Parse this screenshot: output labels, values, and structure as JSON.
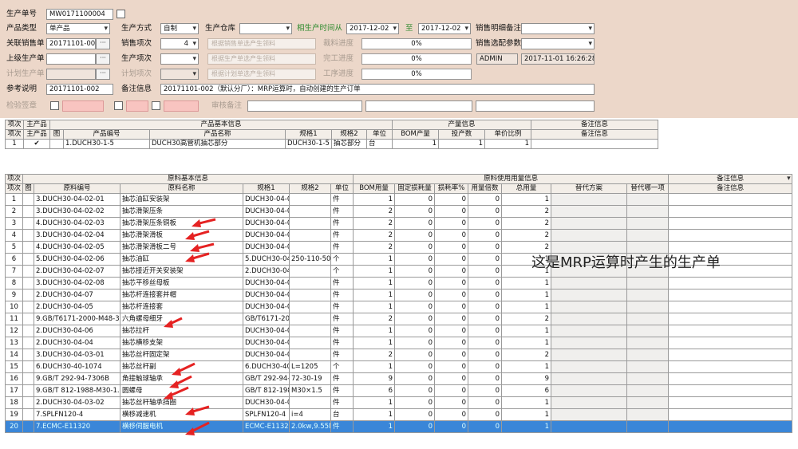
{
  "form": {
    "order_no_label": "生产单号",
    "order_no": "MW0171100004",
    "product_type_label": "产品类型",
    "product_type": "单产品",
    "production_mode_label": "生产方式",
    "production_mode": "自制",
    "warehouse_label": "生产仓库",
    "warehouse": "",
    "date_label": "相生产时间从",
    "date_from": "2017-12-02",
    "date_to_label": "至",
    "date_to": "2017-12-02",
    "sales_note_label": "销售明细备注",
    "sales_note": "",
    "related_sales_label": "关联销售单",
    "related_sales": "20171101-001",
    "sales_item_label": "销售项次",
    "sales_item": "4",
    "btn_sales_material": "根据销售单选产生领料",
    "cut_progress_label": "裁料进度",
    "cut_progress": "0%",
    "sales_config_label": "销售选配参数",
    "sales_config": "",
    "parent_order_label": "上级生产单",
    "parent_order": "",
    "production_item_label": "生产项次",
    "production_item": "",
    "btn_parent_material": "根据生产单选产生领料",
    "complete_progress_label": "完工进度",
    "complete_progress": "0%",
    "user": "ADMIN",
    "created_at": "2017-11-01 16:26:28",
    "related_plan_label": "计划生产单",
    "related_plan": "",
    "plan_item_label": "计划项次",
    "btn_plan_material": "根据计划单选产生领料",
    "process_progress_label": "工序进度",
    "process_progress": "0%",
    "ref_note_label": "参考说明",
    "ref_note": "20171101-002",
    "remark_label": "备注信息",
    "remark": "20171101-002（默认分厂）：MRP运算时，自动创建的生产订单",
    "inspect_label": "检验签章",
    "audit_label": "审核备注"
  },
  "product_table": {
    "group_headers": [
      "项次",
      "主产品",
      "产品基本信息",
      "产量信息",
      "备注信息"
    ],
    "headers": [
      "项次",
      "主产品",
      "图",
      "产品编号",
      "产品名称",
      "规格1",
      "规格2",
      "单位",
      "BOM产量",
      "投产数",
      "单价比例",
      "备注信息"
    ],
    "rows": [
      {
        "idx": "1",
        "main": "✔",
        "pic": "",
        "code": "1.DUCH30-1-5",
        "name": "DUCH30高管机抽芯部分",
        "spec1": "DUCH30-1-5",
        "spec2": "抽芯部分",
        "unit": "台",
        "bom": "1",
        "qty": "1",
        "ratio": "1",
        "note": ""
      }
    ]
  },
  "material_table": {
    "group_headers": [
      "项次",
      "原料基本信息",
      "原料使用用量信息",
      "备注信息"
    ],
    "headers": [
      "项次",
      "图",
      "原料编号",
      "原料名称",
      "规格1",
      "规格2",
      "单位",
      "BOM用量",
      "固定损耗量",
      "损耗率%",
      "用量倍数",
      "总用量",
      "替代方案",
      "替代哪一项",
      "备注信息"
    ],
    "rows": [
      {
        "idx": "1",
        "code": "3.DUCH30-04-02-01",
        "name": "抽芯油缸安装架",
        "spec1": "DUCH30-04-02",
        "spec2": "",
        "unit": "件",
        "bom": "1",
        "fixed": "0",
        "rate": "0",
        "mult": "0",
        "total": "1"
      },
      {
        "idx": "2",
        "code": "3.DUCH30-04-02-02",
        "name": "抽芯滑架压条",
        "spec1": "DUCH30-04-02",
        "spec2": "",
        "unit": "件",
        "bom": "2",
        "fixed": "0",
        "rate": "0",
        "mult": "0",
        "total": "2"
      },
      {
        "idx": "3",
        "code": "4.DUCH30-04-02-03",
        "name": "抽芯滑架压条铜板",
        "spec1": "DUCH30-04-02",
        "spec2": "",
        "unit": "件",
        "bom": "2",
        "fixed": "0",
        "rate": "0",
        "mult": "0",
        "total": "2"
      },
      {
        "idx": "4",
        "code": "3.DUCH30-04-02-04",
        "name": "抽芯滑架滑板",
        "spec1": "DUCH30-04-02",
        "spec2": "",
        "unit": "件",
        "bom": "2",
        "fixed": "0",
        "rate": "0",
        "mult": "0",
        "total": "2"
      },
      {
        "idx": "5",
        "code": "4.DUCH30-04-02-05",
        "name": "抽芯滑架滑板二号",
        "spec1": "DUCH30-04-02",
        "spec2": "",
        "unit": "件",
        "bom": "2",
        "fixed": "0",
        "rate": "0",
        "mult": "0",
        "total": "2"
      },
      {
        "idx": "6",
        "code": "5.DUCH30-04-02-06",
        "name": "抽芯油缸",
        "spec1": "5.DUCH30-04-",
        "spec2": "250-110-500",
        "unit": "个",
        "bom": "1",
        "fixed": "0",
        "rate": "0",
        "mult": "0",
        "total": "1"
      },
      {
        "idx": "7",
        "code": "2.DUCH30-04-02-07",
        "name": "抽芯接近开关安装架",
        "spec1": "2.DUCH30-04-",
        "spec2": "",
        "unit": "个",
        "bom": "1",
        "fixed": "0",
        "rate": "0",
        "mult": "0",
        "total": "1"
      },
      {
        "idx": "8",
        "code": "3.DUCH30-04-02-08",
        "name": "抽芯平移丝母板",
        "spec1": "DUCH30-04-02",
        "spec2": "",
        "unit": "件",
        "bom": "1",
        "fixed": "0",
        "rate": "0",
        "mult": "0",
        "total": "1"
      },
      {
        "idx": "9",
        "code": "2.DUCH30-04-07",
        "name": "抽芯杆连接套并帽",
        "spec1": "DUCH30-04-07",
        "spec2": "",
        "unit": "件",
        "bom": "1",
        "fixed": "0",
        "rate": "0",
        "mult": "0",
        "total": "1"
      },
      {
        "idx": "10",
        "code": "2.DUCH30-04-05",
        "name": "抽芯杆连接套",
        "spec1": "DUCH30-04-05",
        "spec2": "",
        "unit": "件",
        "bom": "1",
        "fixed": "0",
        "rate": "0",
        "mult": "0",
        "total": "1"
      },
      {
        "idx": "11",
        "code": "9.GB/T6171-2000-M48-3",
        "name": "六角螺母细牙",
        "spec1": "GB/T6171-200",
        "spec2": "",
        "unit": "件",
        "bom": "2",
        "fixed": "0",
        "rate": "0",
        "mult": "0",
        "total": "2"
      },
      {
        "idx": "12",
        "code": "2.DUCH30-04-06",
        "name": "抽芯拉杆",
        "spec1": "DUCH30-04-06",
        "spec2": "",
        "unit": "件",
        "bom": "1",
        "fixed": "0",
        "rate": "0",
        "mult": "0",
        "total": "1"
      },
      {
        "idx": "13",
        "code": "2.DUCH30-04-04",
        "name": "抽芯横移支架",
        "spec1": "DUCH30-04-04",
        "spec2": "",
        "unit": "件",
        "bom": "1",
        "fixed": "0",
        "rate": "0",
        "mult": "0",
        "total": "1"
      },
      {
        "idx": "14",
        "code": "3.DUCH30-04-03-01",
        "name": "抽芯丝杆固定架",
        "spec1": "DUCH30-04-03",
        "spec2": "",
        "unit": "件",
        "bom": "2",
        "fixed": "0",
        "rate": "0",
        "mult": "0",
        "total": "2"
      },
      {
        "idx": "15",
        "code": "6.DUCH30-40-1074",
        "name": "抽芯丝杆副",
        "spec1": "6.DUCH30-40-",
        "spec2": "L=1205",
        "unit": "个",
        "bom": "1",
        "fixed": "0",
        "rate": "0",
        "mult": "0",
        "total": "1"
      },
      {
        "idx": "16",
        "code": "9.GB/T 292-94-7306B",
        "name": "角接触球轴承",
        "spec1": "GB/T 292-94-",
        "spec2": "72-30-19",
        "unit": "件",
        "bom": "9",
        "fixed": "0",
        "rate": "0",
        "mult": "0",
        "total": "9"
      },
      {
        "idx": "17",
        "code": "9.GB/T 812-1988-M30-1.5",
        "name": "圆螺母",
        "spec1": "GB/T 812-198",
        "spec2": "M30×1.5",
        "unit": "件",
        "bom": "6",
        "fixed": "0",
        "rate": "0",
        "mult": "0",
        "total": "6"
      },
      {
        "idx": "18",
        "code": "2.DUCH30-04-03-02",
        "name": "抽芯丝杆轴承挡圈",
        "spec1": "DUCH30-04-03",
        "spec2": "",
        "unit": "件",
        "bom": "1",
        "fixed": "0",
        "rate": "0",
        "mult": "0",
        "total": "1"
      },
      {
        "idx": "19",
        "code": "7.SPLFN120-4",
        "name": "横移减速机",
        "spec1": "SPLFN120-4",
        "spec2": "i=4",
        "unit": "台",
        "bom": "1",
        "fixed": "0",
        "rate": "0",
        "mult": "0",
        "total": "1"
      },
      {
        "idx": "20",
        "code": "7.ECMC-E11320",
        "name": "横移伺服电机",
        "spec1": "ECMC-E11320",
        "spec2": "2.0kw,9.55N",
        "unit": "件",
        "bom": "1",
        "fixed": "0",
        "rate": "0",
        "mult": "0",
        "total": "1"
      }
    ]
  },
  "annotation": "这是MRP运算时产生的生产单",
  "colors": {
    "form_bg": "#ecd7c9",
    "selected_row": "#3a86d8",
    "arrow": "#e52222"
  }
}
